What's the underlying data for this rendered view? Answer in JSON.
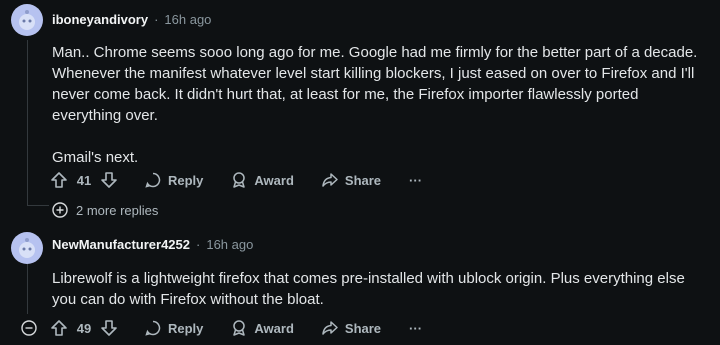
{
  "comments": [
    {
      "author": "iboneyandivory",
      "separator": "·",
      "time": "16h ago",
      "paragraphs": [
        "Man.. Chrome seems sooo long ago for me. Google had me firmly for the better part of a decade. Whenever the manifest whatever level start killing blockers, I just eased on over to Firefox and I'll never come back. It didn't hurt that, at least for me, the Firefox importer flawlessly ported everything over.",
        "Gmail's next."
      ],
      "score": "41",
      "reply_label": "Reply",
      "award_label": "Award",
      "share_label": "Share",
      "more_label": "···"
    },
    {
      "author": "NewManufacturer4252",
      "separator": "·",
      "time": "16h ago",
      "paragraphs": [
        "Librewolf is a lightweight firefox that comes pre-installed with ublock origin. Plus everything else you can do with Firefox without the bloat."
      ],
      "score": "49",
      "reply_label": "Reply",
      "award_label": "Award",
      "share_label": "Share",
      "more_label": "···"
    }
  ],
  "more_replies_label": "2 more replies",
  "colors": {
    "background": "#0e1113",
    "text": "#d7dadc",
    "muted": "#8a979e",
    "avatar": "#b6c2f0"
  }
}
